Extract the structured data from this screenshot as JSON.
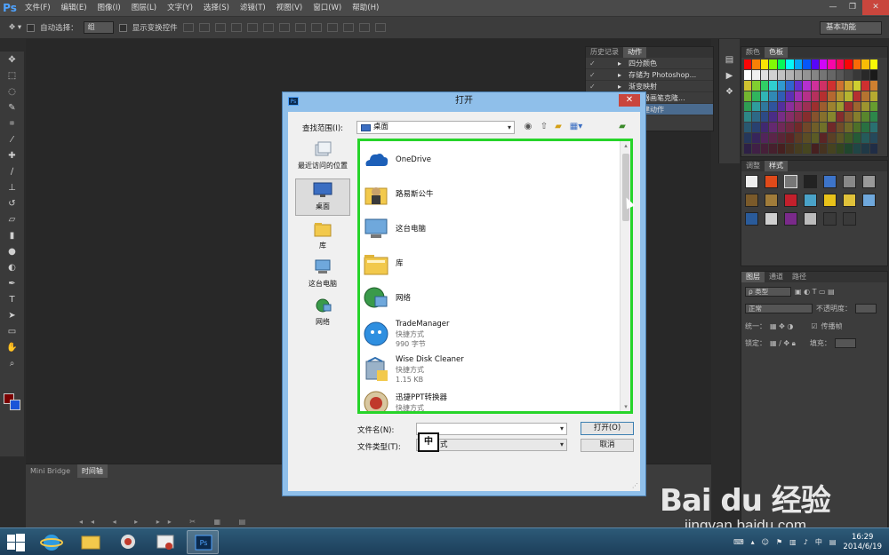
{
  "menubar": {
    "logo": "Ps",
    "items": [
      "文件(F)",
      "编辑(E)",
      "图像(I)",
      "图层(L)",
      "文字(Y)",
      "选择(S)",
      "滤镜(T)",
      "视图(V)",
      "窗口(W)",
      "帮助(H)"
    ],
    "win_min": "—",
    "win_max": "❐",
    "win_close": "✕"
  },
  "optionsbar": {
    "auto_select_label": "自动选择：",
    "auto_select_value": "组",
    "show_transform_label": "显示变换控件",
    "workspace": "基本功能"
  },
  "history_panel": {
    "tabs": [
      "历史记录",
      "动作"
    ],
    "actions": [
      "四分颜色",
      "存储为 Photoshop...",
      "渐变映射",
      "混合器画笔克隆...",
      "已创建动作"
    ]
  },
  "color_panel": {
    "tabs": [
      "颜色",
      "色板"
    ]
  },
  "styles_panel": {
    "tabs": [
      "调整",
      "样式"
    ]
  },
  "layers_panel": {
    "tabs": [
      "图层",
      "通道",
      "路径"
    ],
    "kind_filter": "ρ 类型",
    "blend_mode": "正常",
    "opacity_label": "不透明度：",
    "lock_label": "锁定：",
    "fill_label": "填充：",
    "unify_label": "统一：",
    "propagate_label": "传播帧"
  },
  "timeline": {
    "tabs": [
      "Mini Bridge",
      "时间轴"
    ]
  },
  "dialog": {
    "title": "打开",
    "lookin_label": "查找范围(I):",
    "lookin_value": "桌面",
    "places": [
      "最近访问的位置",
      "桌面",
      "库",
      "这台电脑",
      "网络"
    ],
    "files": [
      {
        "name": "OneDrive",
        "sub1": "",
        "sub2": ""
      },
      {
        "name": "路易斯公牛",
        "sub1": "",
        "sub2": ""
      },
      {
        "name": "这台电脑",
        "sub1": "",
        "sub2": ""
      },
      {
        "name": "库",
        "sub1": "",
        "sub2": ""
      },
      {
        "name": "网络",
        "sub1": "",
        "sub2": ""
      },
      {
        "name": "TradeManager",
        "sub1": "快捷方式",
        "sub2": "990 字节"
      },
      {
        "name": "Wise Disk Cleaner",
        "sub1": "快捷方式",
        "sub2": "1.15 KB"
      },
      {
        "name": "迅捷PPT转换器",
        "sub1": "快捷方式",
        "sub2": ""
      }
    ],
    "filename_label": "文件名(N):",
    "filename_value": "",
    "filetype_label": "文件类型(T):",
    "filetype_value": "式",
    "open_button": "打开(O)",
    "cancel_button": "取消",
    "ime_indicator": "中"
  },
  "taskbar": {
    "time": "16:29",
    "date": "2014/6/19",
    "ime": "中"
  },
  "watermark": {
    "main": "Bai du 经验",
    "sub": "jingyan.baidu.com"
  }
}
